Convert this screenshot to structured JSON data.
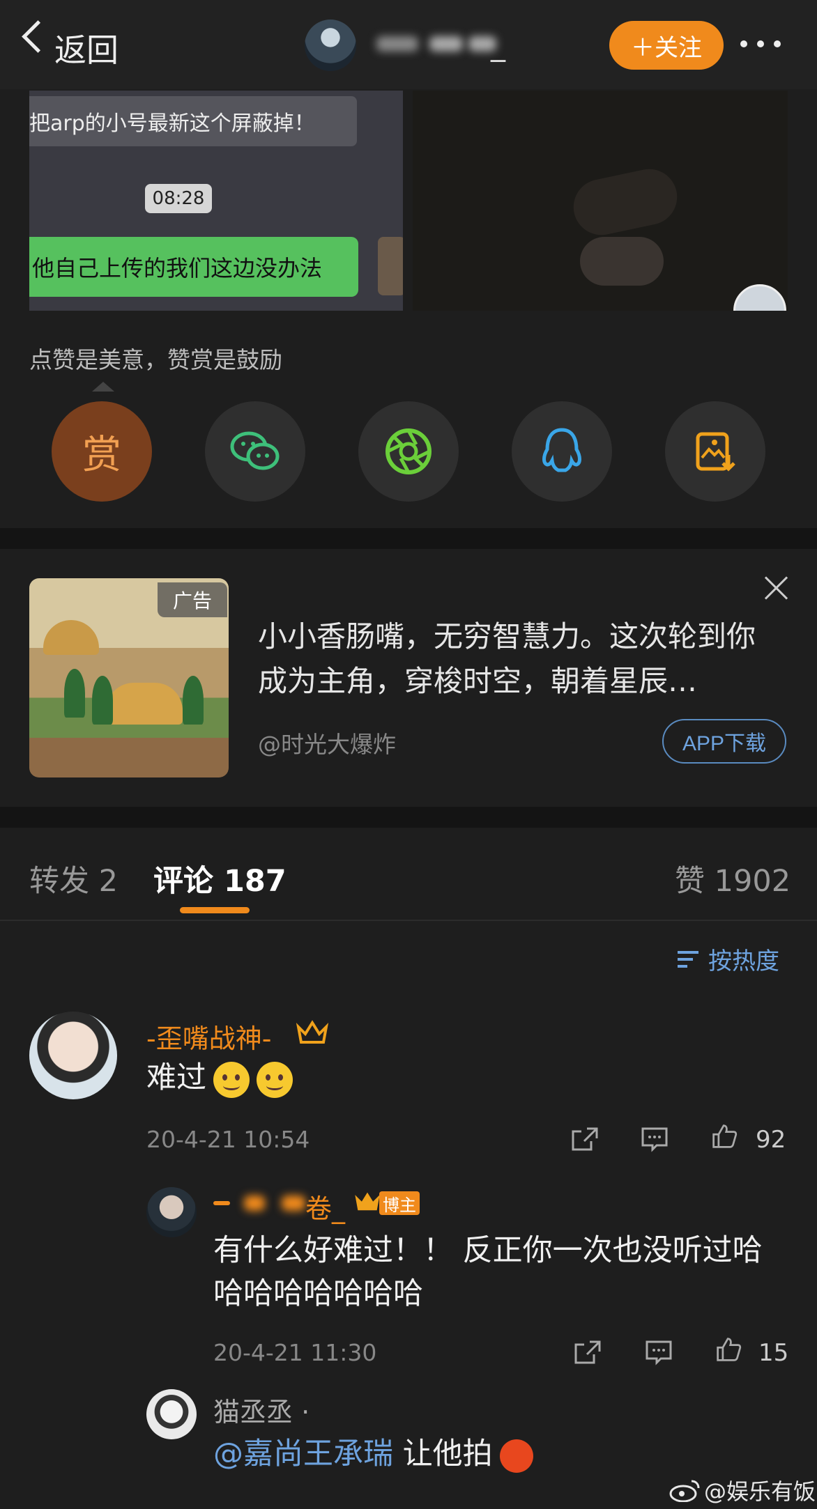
{
  "header": {
    "back_label": "返回",
    "name_suffix": "_",
    "follow_label": "＋关注"
  },
  "post_images": {
    "grey_bubble_text": "把arp的小号最新这个屏蔽掉！",
    "time": "08:28",
    "green_bubble_text": "他自己上传的我们这边没办法"
  },
  "reward_prompt": "点赞是美意，赞赏是鼓励",
  "share": {
    "reward_label": "赏",
    "icons": [
      "reward-icon",
      "wechat-icon",
      "moments-icon",
      "qq-icon",
      "save-image-icon"
    ]
  },
  "ad": {
    "badge": "广告",
    "text": "小小香肠嘴，无穷智慧力。这次轮到你成为主角，穿梭时空，朝着星辰…",
    "source": "@时光大爆炸",
    "button": "APP下载"
  },
  "tabs": {
    "repost": "转发 2",
    "comments": "评论 187",
    "likes": "赞 1902"
  },
  "sort_label": "按热度",
  "comments": [
    {
      "name": "-歪嘴战神-",
      "text": "难过",
      "time": "20-4-21 10:54",
      "likes": "92"
    }
  ],
  "reply": {
    "name_suffix": "卷_",
    "badge": "博主",
    "text": "有什么好难过！！ 反正你一次也没听过哈哈哈哈哈哈哈哈",
    "time": "20-4-21 11:30",
    "likes": "15"
  },
  "sub_reply": {
    "name": "猫丞丞 ·",
    "mention": "@嘉尚王承瑞",
    "text": " 让他拍"
  },
  "watermark": "@娱乐有饭",
  "colors": {
    "accent": "#f08a1c",
    "link": "#6ea3df",
    "background": "#1e1e1e"
  }
}
